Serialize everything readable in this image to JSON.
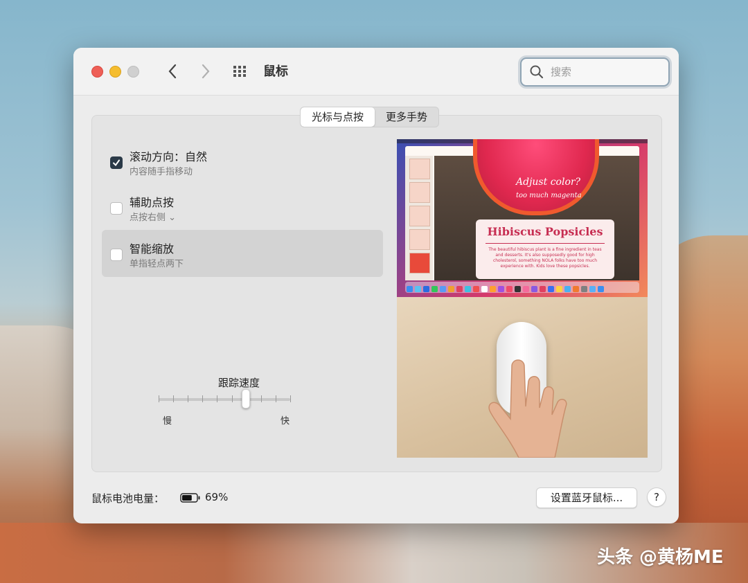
{
  "window": {
    "title": "鼠标",
    "search_placeholder": "搜索"
  },
  "tabs": [
    {
      "label": "光标与点按",
      "selected": true
    },
    {
      "label": "更多手势",
      "selected": false
    }
  ],
  "options": [
    {
      "title": "滚动方向：自然",
      "subtitle": "内容随手指移动",
      "checked": true
    },
    {
      "title": "辅助点按",
      "subtitle": "点按右侧 ⌄",
      "checked": false
    },
    {
      "title": "智能缩放",
      "subtitle": "单指轻点两下",
      "checked": false
    }
  ],
  "tracking": {
    "label": "跟踪速度",
    "min_label": "慢",
    "max_label": "快",
    "value_fraction": 0.66,
    "tick_count": 10
  },
  "preview": {
    "card_title": "Hibiscus Popsicles",
    "card_text": "The beautiful hibiscus plant is a fine ingredient in teas and desserts. It's also supposedly good for high cholesterol, something NOLA folks have too much experience with. Kids love these popsicles.",
    "handwriting": "Adjust color?",
    "handwriting2": "too much magenta"
  },
  "footer": {
    "battery_label": "鼠标电池电量：",
    "battery_percent": "69%",
    "battery_level": 0.69,
    "bluetooth_button": "设置蓝牙鼠标...",
    "help_button": "?"
  },
  "watermark": "头条 @黄杨ME",
  "colors": {
    "close": "#ee5f57",
    "minimize": "#f5bd2f",
    "checkbox_checked": "#2b3a48",
    "search_focus": "#8fa4b4"
  }
}
